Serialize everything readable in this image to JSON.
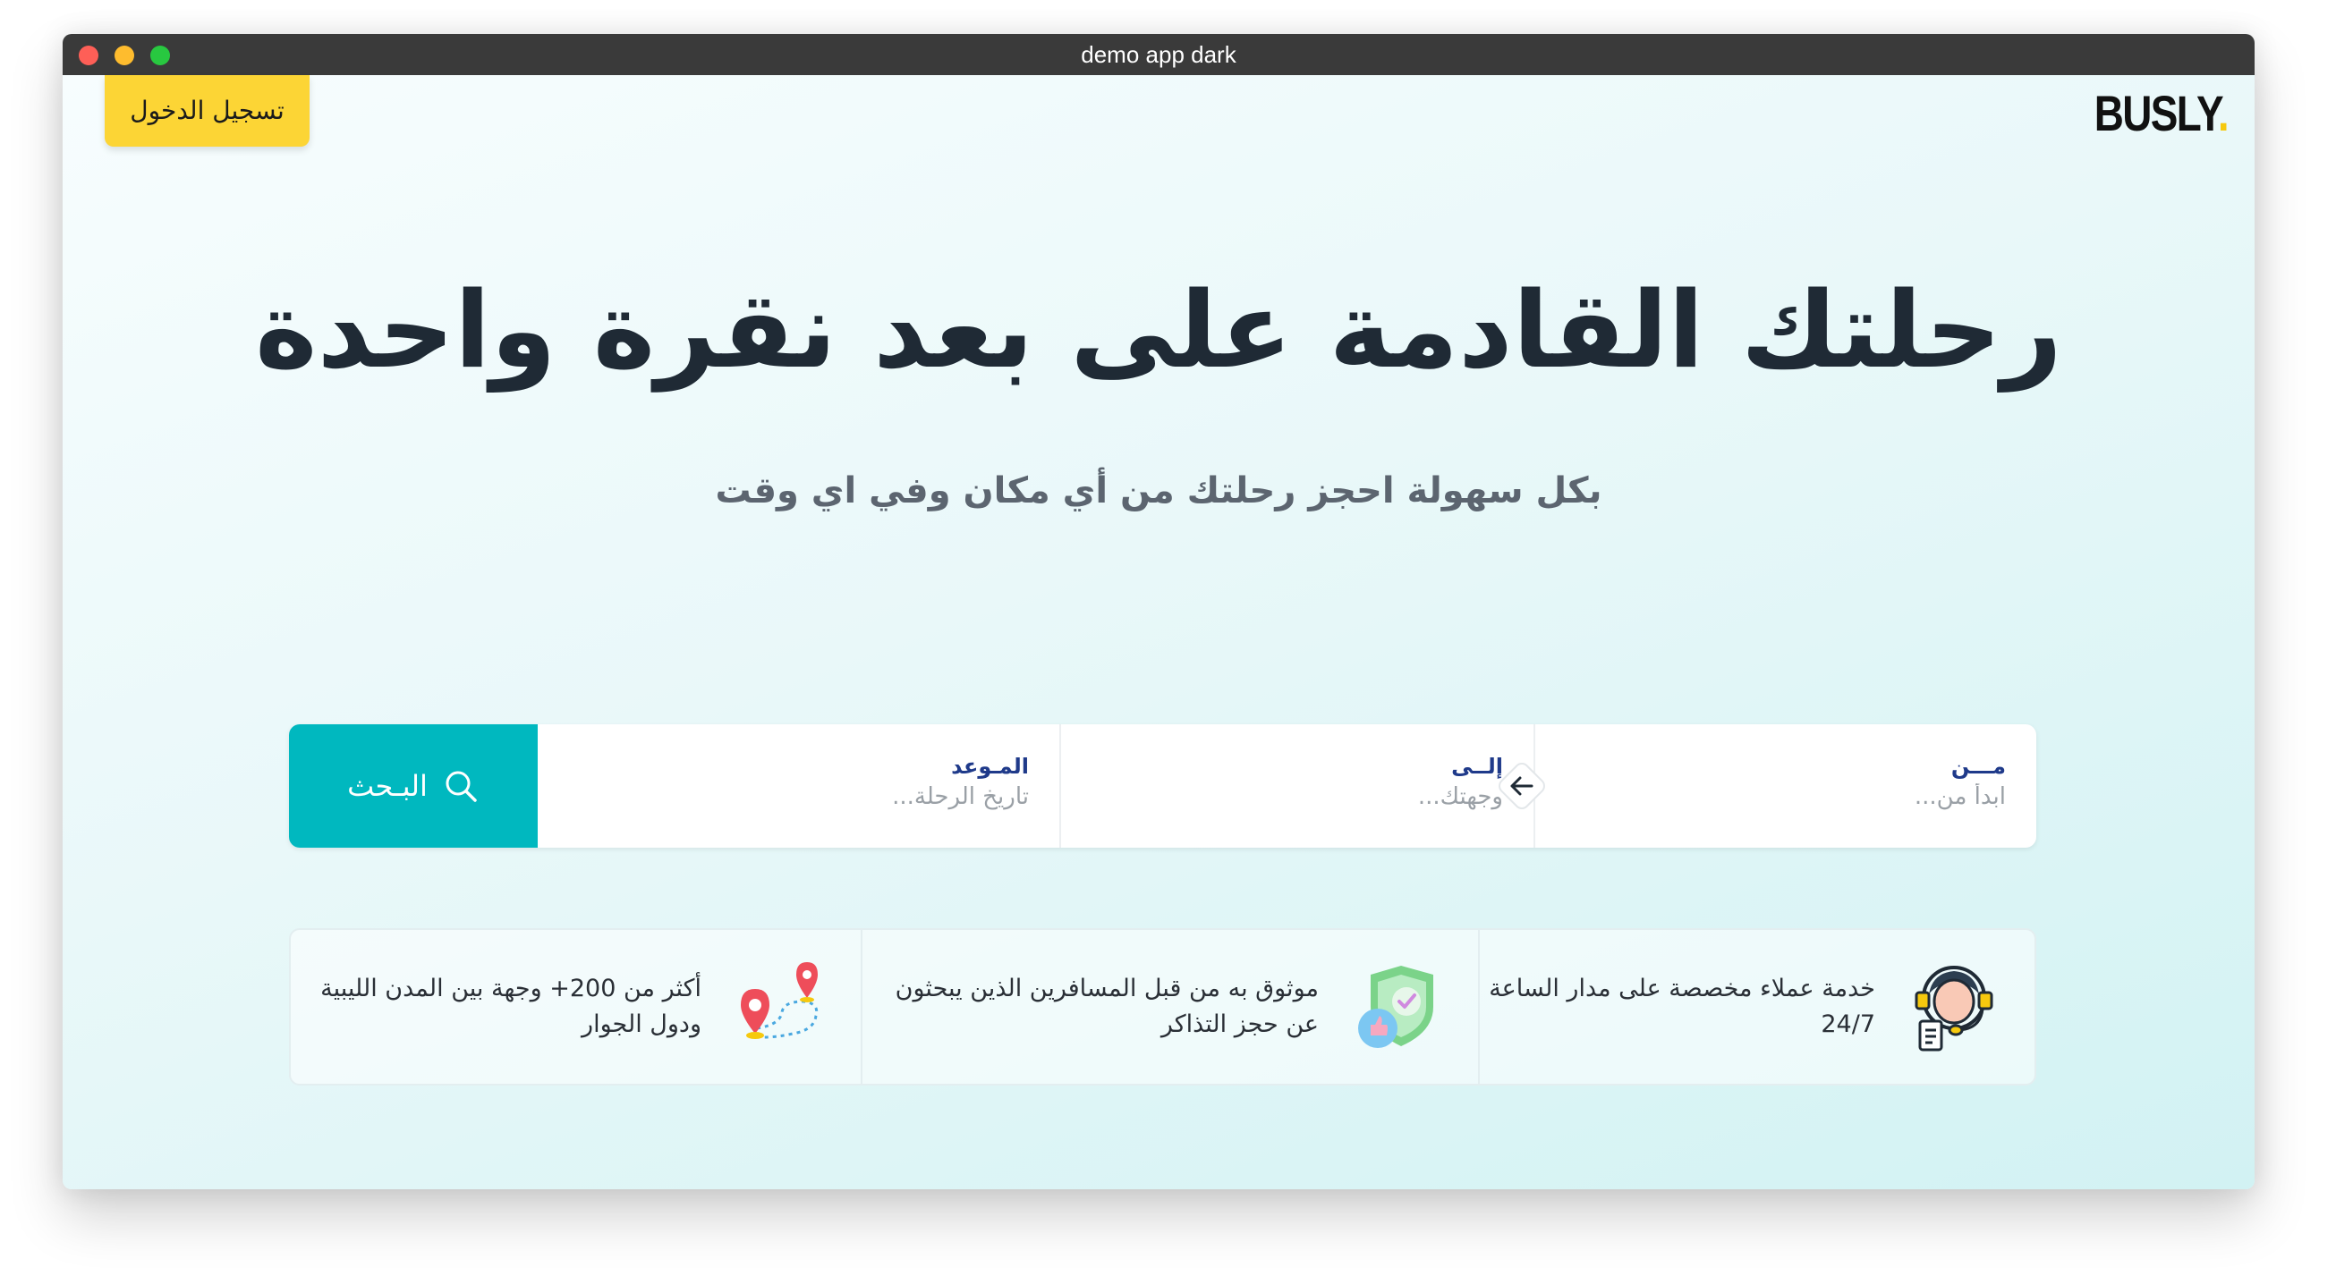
{
  "window": {
    "title": "demo app dark"
  },
  "header": {
    "logo_text": "BUSLY",
    "logo_dot": ".",
    "login_label": "تسجيل الدخول",
    "accent_color": "#fcd535"
  },
  "hero": {
    "title": "رحلتك القادمة على بعد نقرة واحدة",
    "subtitle": "بكل سهولة احجز رحلتك من أي مكان وفي اي وقت"
  },
  "search": {
    "from": {
      "label": "مـــن",
      "placeholder": "ابدأ من..."
    },
    "to": {
      "label": "إلــى",
      "placeholder": "وجهتك..."
    },
    "date": {
      "label": "المـوعد",
      "placeholder": "تاريخ الرحلة..."
    },
    "button_label": "البـحث",
    "button_color": "#00b8bf",
    "swap_icon": "arrow-left-icon"
  },
  "features": [
    {
      "icon": "customer-support-icon",
      "text": "خدمة عملاء مخصصة على مدار الساعة 24/7"
    },
    {
      "icon": "trusted-shield-icon",
      "text": "موثوق به من قبل المسافرين الذين يبحثون عن حجز التذاكر"
    },
    {
      "icon": "map-pins-route-icon",
      "text": "أكثر من 200+ وجهة بين المدن الليبية ودول الجوار"
    }
  ]
}
